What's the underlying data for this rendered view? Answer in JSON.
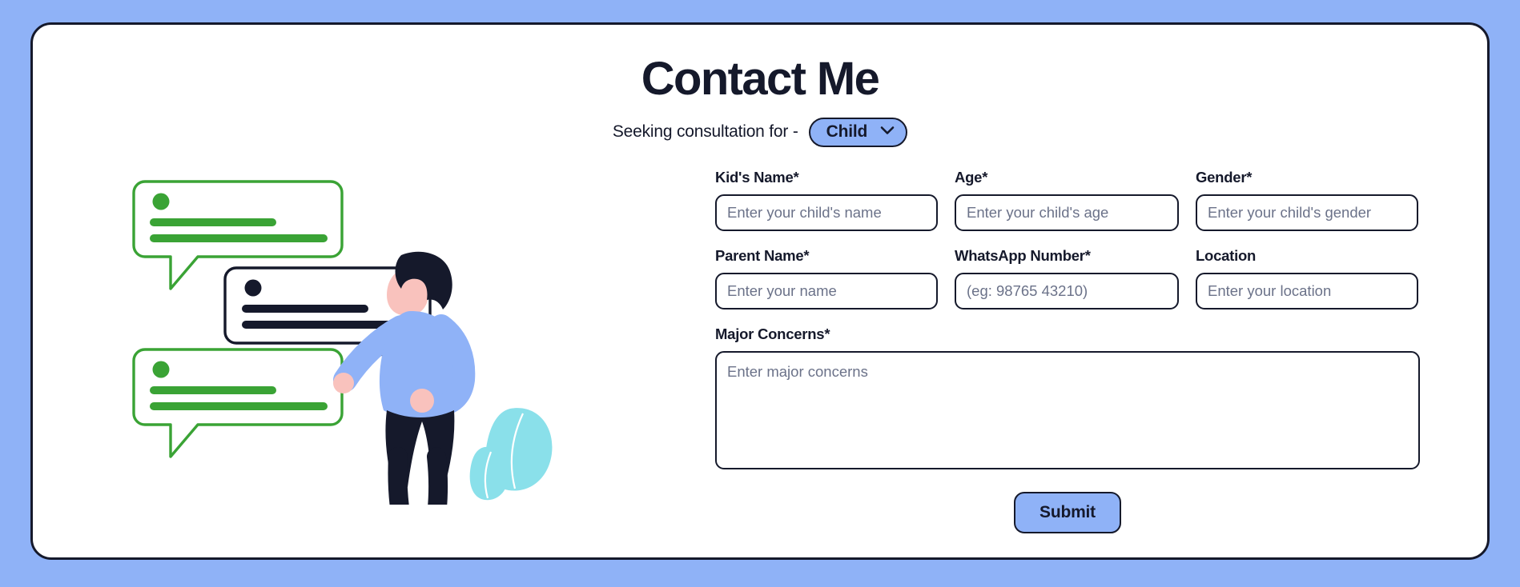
{
  "background_color": "#8fb2f7",
  "card_border_color": "#15192b",
  "accent_color": "#8fb2f7",
  "header": {
    "title": "Contact Me",
    "subtitle_prefix": "Seeking consultation for -",
    "consultation_select": {
      "name": "consultation-for-select",
      "value": "Child",
      "icon": "chevron-down-icon",
      "options": [
        "Child"
      ]
    }
  },
  "illustration": {
    "name": "chat-bubbles-person-illustration",
    "bubbles": [
      {
        "name": "green-bubble-top",
        "color": "#3aa335",
        "dot": "#3aa335"
      },
      {
        "name": "dark-bubble-middle",
        "color": "#15192b",
        "dot": "#15192b"
      },
      {
        "name": "green-bubble-bottom",
        "color": "#3aa335",
        "dot": "#3aa335"
      }
    ],
    "person": {
      "hair": "#15192b",
      "skin": "#f9c2bd",
      "shirt": "#8fb2f7",
      "pants": "#15192b",
      "shoes": "#15192b"
    },
    "plant_color": "#8ae0ea",
    "ground_color": "#15192b"
  },
  "form": {
    "rows": [
      [
        {
          "name": "kids-name",
          "label": "Kid's Name",
          "required": true,
          "placeholder": "Enter your child's name",
          "value": ""
        },
        {
          "name": "age",
          "label": "Age",
          "required": true,
          "placeholder": "Enter your child's age",
          "value": ""
        },
        {
          "name": "gender",
          "label": "Gender",
          "required": true,
          "placeholder": "Enter your child's gender",
          "value": ""
        }
      ],
      [
        {
          "name": "parent-name",
          "label": "Parent Name",
          "required": true,
          "placeholder": "Enter your name",
          "value": ""
        },
        {
          "name": "whatsapp-number",
          "label": "WhatsApp Number",
          "required": true,
          "placeholder": "(eg: 98765 43210)",
          "value": ""
        },
        {
          "name": "location",
          "label": "Location",
          "required": false,
          "placeholder": "Enter your location",
          "value": ""
        }
      ]
    ],
    "major_concerns": {
      "name": "major-concerns",
      "label": "Major Concerns",
      "required": true,
      "placeholder": "Enter major concerns",
      "value": ""
    },
    "submit": {
      "name": "submit-button",
      "label": "Submit"
    },
    "required_marker": "*"
  }
}
